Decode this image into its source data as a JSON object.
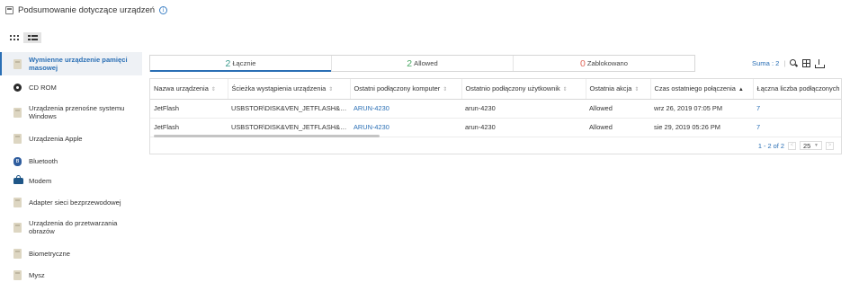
{
  "header": {
    "title": "Podsumowanie dotyczące urządzeń",
    "info_icon": "info-icon"
  },
  "view_toggle": [
    {
      "icon": "grid-icon",
      "active": false
    },
    {
      "icon": "list-icon",
      "active": true
    }
  ],
  "sidebar": {
    "items": [
      {
        "label": "Wymienne urządzenie pamięci masowej",
        "icon": "usb-drive-icon",
        "active": true
      },
      {
        "label": "CD ROM",
        "icon": "cd-icon"
      },
      {
        "label": "Urządzenia przenośne systemu Windows",
        "icon": "portable-device-icon"
      },
      {
        "label": "Urządzenia Apple",
        "icon": "apple-device-icon"
      },
      {
        "label": "Bluetooth",
        "icon": "bluetooth-icon"
      },
      {
        "label": "Modem",
        "icon": "modem-icon"
      },
      {
        "label": "Adapter sieci bezprzewodowej",
        "icon": "wireless-adapter-icon"
      },
      {
        "label": "Urządzenia do przetwarzania obrazów",
        "icon": "imaging-device-icon"
      },
      {
        "label": "Biometryczne",
        "icon": "biometric-icon"
      },
      {
        "label": "Mysz",
        "icon": "mouse-icon"
      }
    ]
  },
  "tabs": [
    {
      "count": "2",
      "label": "Łącznie",
      "color": "#3a9a8c",
      "active": true
    },
    {
      "count": "2",
      "label": "Allowed",
      "color": "#4aa864"
    },
    {
      "count": "0",
      "label": "Zablokowano",
      "color": "#e0685a"
    }
  ],
  "toolbar": {
    "sum_label": "Suma : 2",
    "separator": "|"
  },
  "table": {
    "columns": [
      "Nazwa urządzenia",
      "Ścieżka wystąpienia urządzenia",
      "Ostatni podłączony komputer",
      "Ostatnio podłączony użytkownik",
      "Ostatnia akcja",
      "Czas ostatniego połączenia",
      "Łączna liczba podłączonych"
    ],
    "rows": [
      [
        "JetFlash",
        "USBSTOR\\DISK&VEN_JETFLASH&PR...",
        "ARUN-4230",
        "arun-4230",
        "Allowed",
        "wrz 26, 2019 07:05 PM",
        "7"
      ],
      [
        "JetFlash",
        "USBSTOR\\DISK&VEN_JETFLASH&PR...",
        "ARUN-4230",
        "arun-4230",
        "Allowed",
        "sie 29, 2019 05:26 PM",
        "7"
      ]
    ]
  },
  "pagination": {
    "range": "1 - 2 of 2",
    "page_size": "25",
    "prev": "<",
    "next": ">"
  }
}
